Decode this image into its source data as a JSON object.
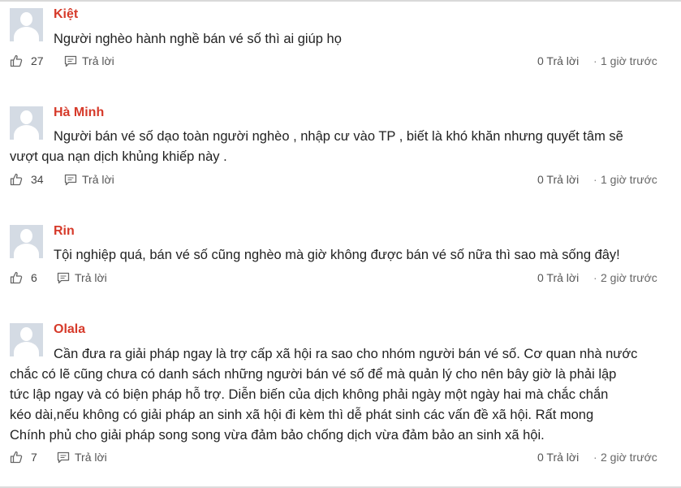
{
  "comments": [
    {
      "name": "Kiệt",
      "text_lines": [
        "Người nghèo hành nghề bán vé số thì ai giúp họ"
      ],
      "likes": "27",
      "reply_label": "Trả lời",
      "replies": "0 Trả lời",
      "separator": "·",
      "time": "1 giờ trước"
    },
    {
      "name": "Hà Minh",
      "text_lines": [
        "Người bán vé số dạo toàn người nghèo , nhập cư vào TP , biết là khó khăn nhưng quyết tâm sẽ",
        "vượt qua nạn dịch khủng khiếp này ."
      ],
      "likes": "34",
      "reply_label": "Trả lời",
      "replies": "0 Trả lời",
      "separator": "·",
      "time": "1 giờ trước"
    },
    {
      "name": "Rin",
      "text_lines": [
        "Tội nghiệp quá, bán vé số cũng nghèo mà giờ không được bán vé số nữa thì sao mà sống đây!"
      ],
      "likes": "6",
      "reply_label": "Trả lời",
      "replies": "0 Trả lời",
      "separator": "·",
      "time": "2 giờ trước"
    },
    {
      "name": "Olala",
      "text_lines": [
        "Cần đưa ra giải pháp ngay là trợ cấp xã hội ra sao cho nhóm người bán vé số. Cơ quan nhà nước",
        "chắc có lẽ cũng chưa có danh sách những người bán vé số để mà quản lý cho nên bây giờ là phải lập",
        "tức lập ngay và có biện pháp hỗ trợ. Diễn biến của dịch không phải ngày một ngày hai mà chắc chắn",
        "kéo dài,nếu không có giải pháp an sinh xã hội đi kèm thì dễ phát sinh các vấn đề xã hội. Rất mong",
        "Chính phủ cho giải pháp song song vừa đảm bảo chống dịch vừa đảm bảo an sinh xã hội."
      ],
      "likes": "7",
      "reply_label": "Trả lời",
      "replies": "0 Trả lời",
      "separator": "·",
      "time": "2 giờ trước"
    }
  ],
  "icons": {
    "like": "thumbs-up-icon",
    "reply": "speech-bubble-icon"
  },
  "colors": {
    "author_name": "#d63a2a",
    "avatar_bg": "#d4dbe4"
  }
}
